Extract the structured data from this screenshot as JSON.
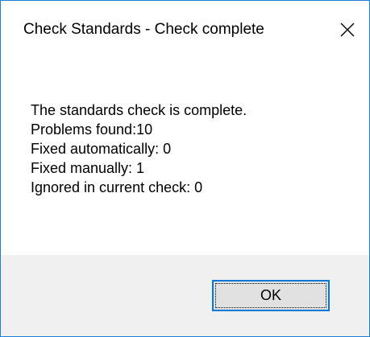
{
  "window": {
    "title": "Check Standards - Check complete"
  },
  "message": {
    "line1": "The standards check is complete.",
    "line2": "Problems found:10",
    "line3": "Fixed automatically: 0",
    "line4": "Fixed manually: 1",
    "line5": "Ignored in current check: 0"
  },
  "buttons": {
    "ok_label": "OK"
  },
  "colors": {
    "window_border": "#1c7ed6",
    "button_focus_border": "#0078d7",
    "footer_background": "#f0f0f0"
  },
  "icons": {
    "close": "close-icon"
  }
}
